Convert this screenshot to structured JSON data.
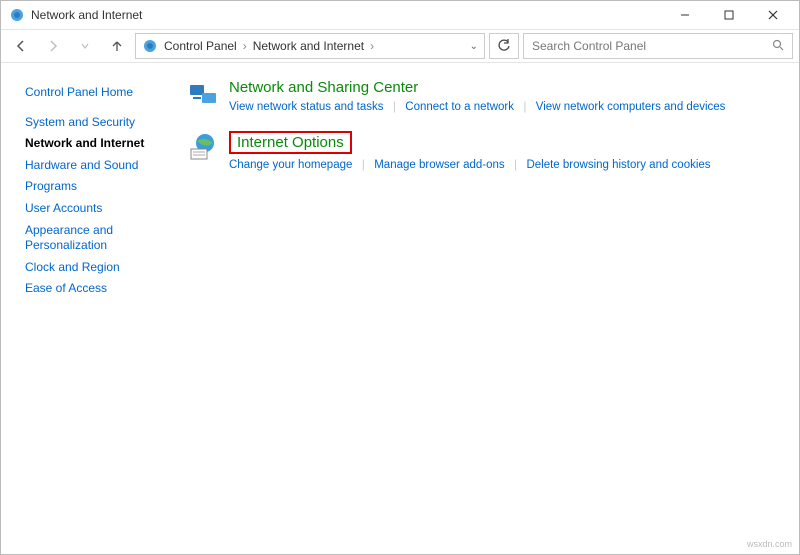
{
  "title": "Network and Internet",
  "breadcrumb": {
    "root": "Control Panel",
    "current": "Network and Internet"
  },
  "search": {
    "placeholder": "Search Control Panel"
  },
  "sidebar": {
    "home": "Control Panel Home",
    "items": [
      "System and Security",
      "Network and Internet",
      "Hardware and Sound",
      "Programs",
      "User Accounts",
      "Appearance and Personalization",
      "Clock and Region",
      "Ease of Access"
    ],
    "active_index": 1
  },
  "categories": [
    {
      "title": "Network and Sharing Center",
      "tasks": [
        "View network status and tasks",
        "Connect to a network",
        "View network computers and devices"
      ],
      "highlighted": false
    },
    {
      "title": "Internet Options",
      "tasks": [
        "Change your homepage",
        "Manage browser add-ons",
        "Delete browsing history and cookies"
      ],
      "highlighted": true
    }
  ],
  "watermark": "wsxdn.com"
}
